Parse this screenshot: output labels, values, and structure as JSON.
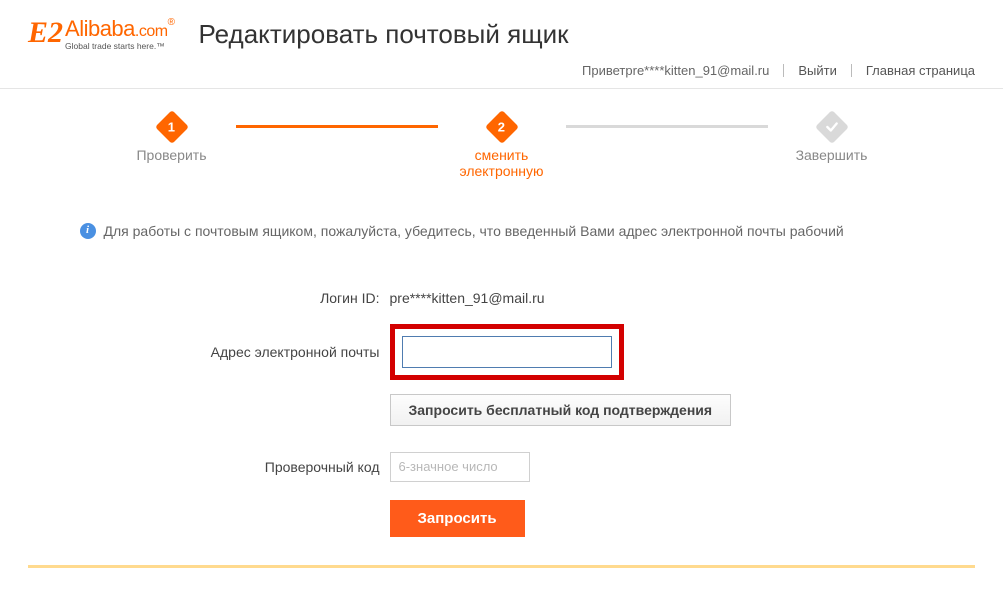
{
  "logo": {
    "brand": "Alibaba",
    "suffix": ".com",
    "tagline": "Global trade starts here.™"
  },
  "page_title": "Редактировать почтовый ящик",
  "topnav": {
    "greeting": "Приветpre****kitten_91@mail.ru",
    "logout": "Выйти",
    "home": "Главная страница"
  },
  "steps": {
    "s1": {
      "num": "1",
      "label": "Проверить"
    },
    "s2": {
      "num": "2",
      "label": "сменить электронную"
    },
    "s3": {
      "label": "Завершить"
    }
  },
  "info": {
    "text": "Для работы с почтовым ящиком, пожалуйста, убедитесь, что введенный Вами адрес электронной почты рабочий"
  },
  "form": {
    "login_label": "Логин ID:",
    "login_value": "pre****kitten_91@mail.ru",
    "email_label": "Адрес электронной почты",
    "email_value": "",
    "request_code_btn": "Запросить бесплатный код подтверждения",
    "code_label": "Проверочный код",
    "code_placeholder": "6-значное число",
    "submit_btn": "Запросить"
  }
}
